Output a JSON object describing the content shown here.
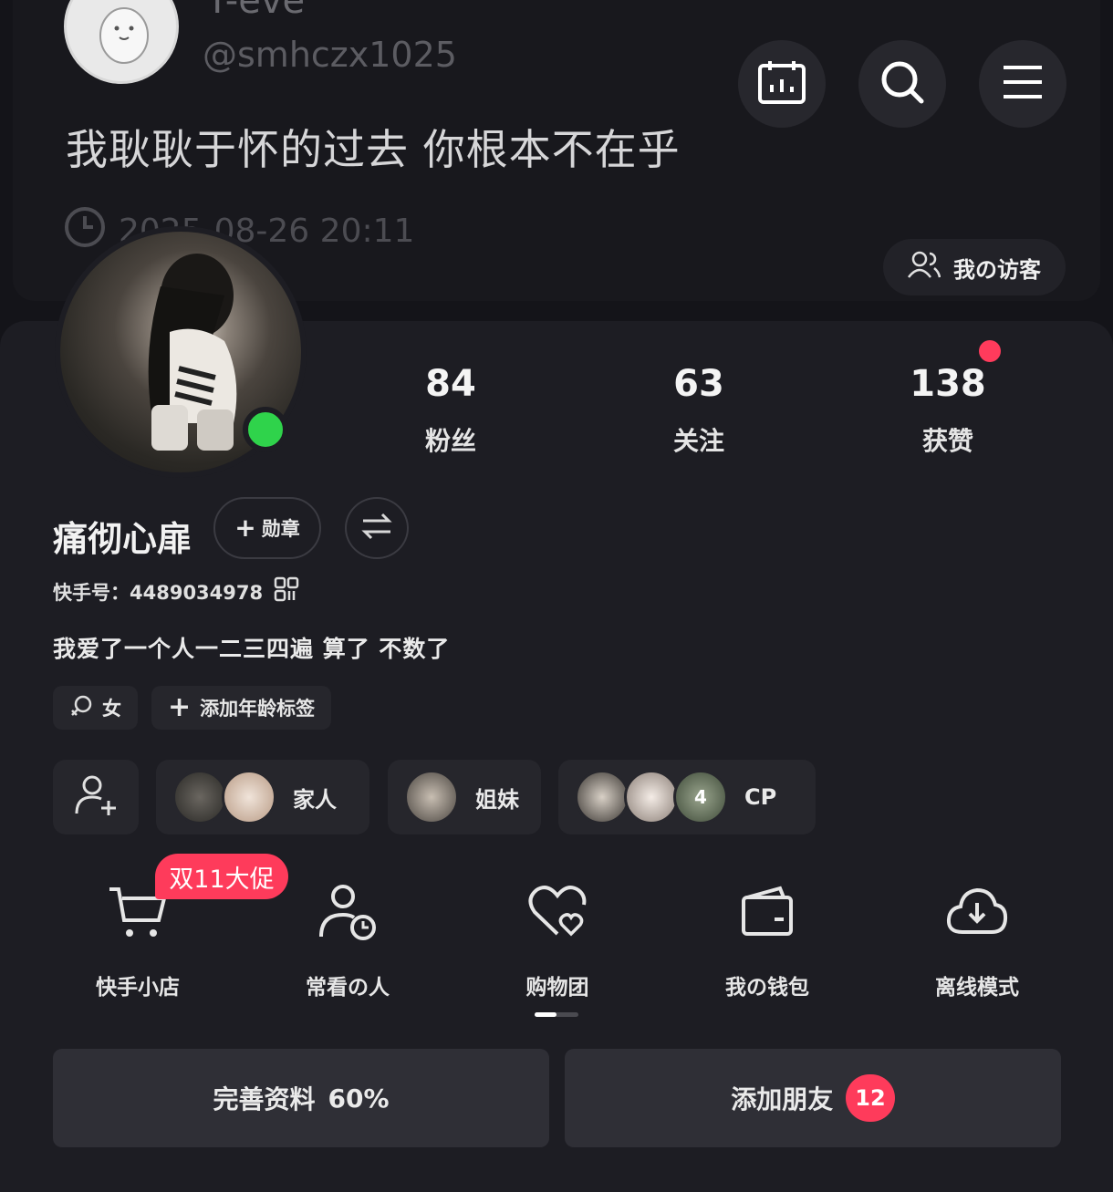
{
  "top_post": {
    "name": "T-eve",
    "handle": "@smhczx1025",
    "text": "我耿耿于怀的过去 你根本不在乎",
    "time": "2025-08-26 20:11"
  },
  "header": {
    "visitors_label": "我の访客"
  },
  "profile": {
    "stats": [
      {
        "value": "84",
        "label": "粉丝"
      },
      {
        "value": "63",
        "label": "关注"
      },
      {
        "value": "138",
        "label": "获赞"
      }
    ],
    "nickname": "痛彻心扉",
    "badge_label": "勋章",
    "kuaishou_id_label": "快手号：",
    "kuaishou_id": "4489034978",
    "bio": "我爱了一个人一二三四遍  算了  不数了",
    "gender_label": "女",
    "add_age_tag_label": "添加年龄标签"
  },
  "relations": [
    {
      "label": "家人",
      "count": ""
    },
    {
      "label": "姐妹",
      "count": ""
    },
    {
      "label": "CP",
      "count": "4"
    }
  ],
  "functions": [
    {
      "label": "快手小店",
      "icon": "cart-icon"
    },
    {
      "label": "常看の人",
      "icon": "person-clock-icon"
    },
    {
      "label": "购物团",
      "icon": "heart-group-icon"
    },
    {
      "label": "我の钱包",
      "icon": "wallet-icon"
    },
    {
      "label": "离线模式",
      "icon": "cloud-download-icon"
    }
  ],
  "promo_label": "双11大促",
  "actions": {
    "complete_profile_label": "完善资料",
    "complete_profile_percent": "60%",
    "add_friends_label": "添加朋友",
    "add_friends_count": "12"
  },
  "colors": {
    "background": "#141419",
    "sheet": "#1d1d23",
    "accent_red": "#fe3b5b",
    "online_green": "#2fd34b"
  }
}
